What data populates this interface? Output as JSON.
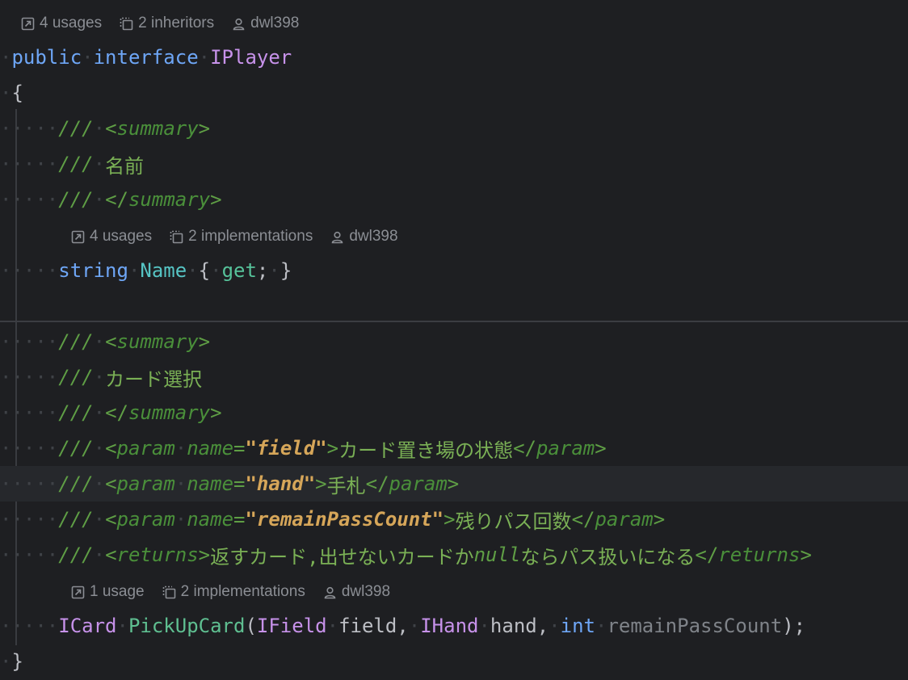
{
  "hints": {
    "interface": {
      "usages": "4 usages",
      "inheritors": "2 inheritors",
      "author": "dwl398"
    },
    "name_prop": {
      "usages": "4 usages",
      "implementations": "2 implementations",
      "author": "dwl398"
    },
    "pickup": {
      "usages": "1 usage",
      "implementations": "2 implementations",
      "author": "dwl398"
    }
  },
  "code": {
    "kw_public": "public",
    "kw_interface": "interface",
    "iface_name": "IPlayer",
    "open_brace": "{",
    "close_brace": "}",
    "doc_slashes": "///",
    "summary_open": "<summary>",
    "summary_close": "</summary>",
    "summary_tag_open_lt": "<",
    "summary_word": "summary",
    "gt": ">",
    "close_lt": "</",
    "name_doc": "名前",
    "kw_string": "string",
    "prop_name": "Name",
    "acc_get": "get",
    "pick_doc": "カード選択",
    "param_tag": "param",
    "attr_name": "name",
    "eq": "=",
    "field_q": "\"field\"",
    "field_desc": "カード置き場の状態",
    "hand_q": "\"hand\"",
    "hand_desc": "手札",
    "remain_q": "\"remainPassCount\"",
    "remain_desc": "残りパス回数",
    "returns_tag": "returns",
    "returns_desc1": "返すカード,出せないカードか",
    "returns_null": "null",
    "returns_desc2": "ならパス扱いになる",
    "type_icard": "ICard",
    "method_name": "PickUpCard",
    "type_ifield": "IField",
    "p_field": "field",
    "type_ihand": "IHand",
    "p_hand": "hand",
    "kw_int": "int",
    "p_remain": "remainPassCount"
  },
  "colors": {
    "background": "#1e1f22",
    "keyword": "#6ea6f6",
    "interface": "#c792ea",
    "comment": "#5f9e45",
    "attr_value": "#d6a659"
  }
}
